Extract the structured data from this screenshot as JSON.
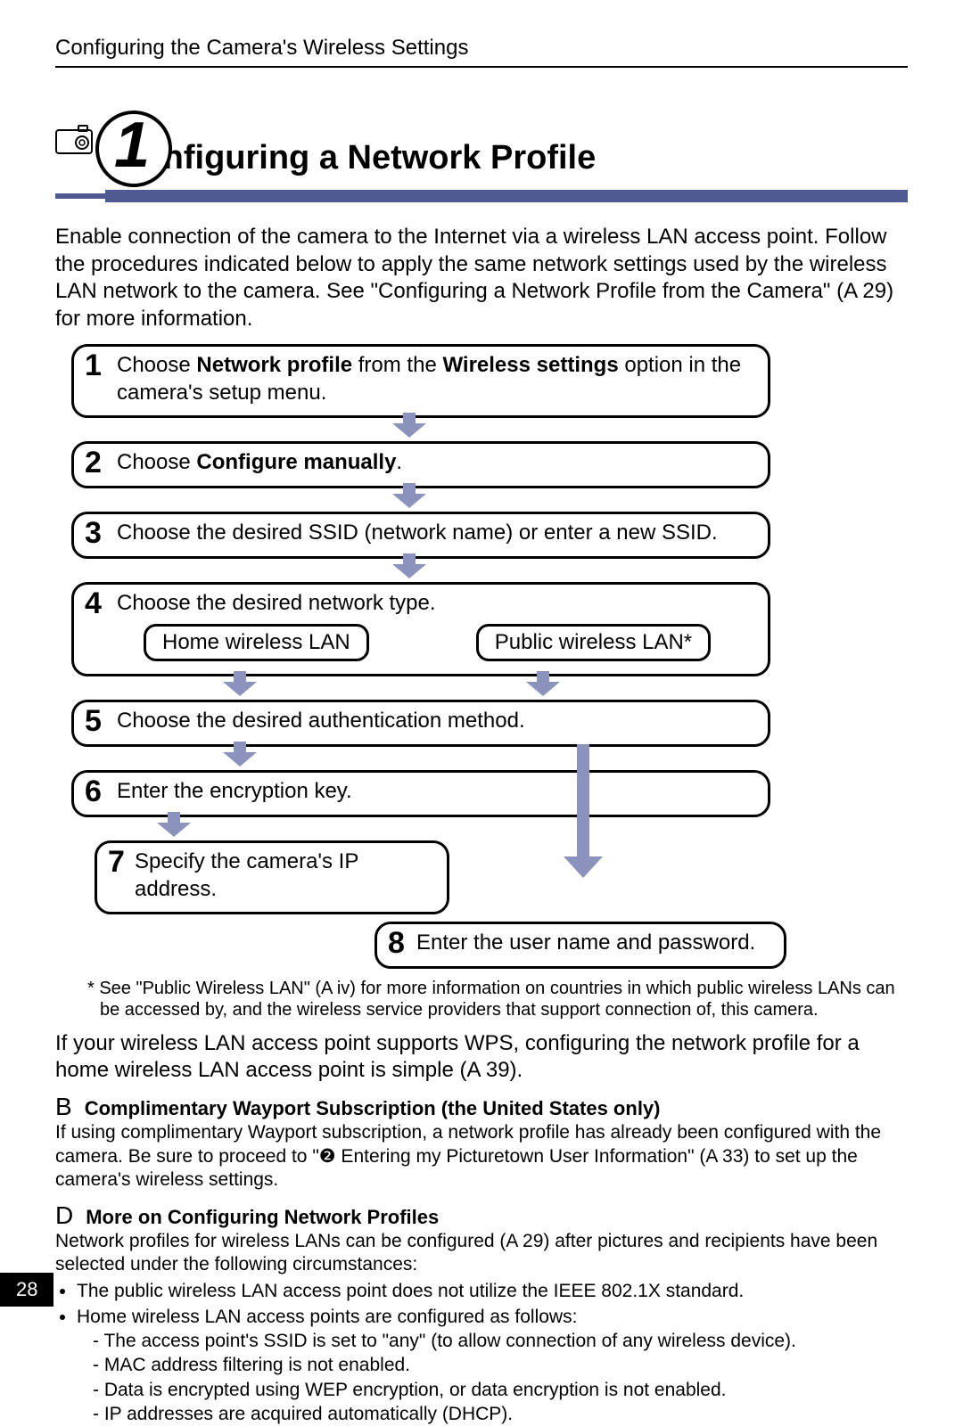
{
  "header": "Configuring the Camera's Wireless Settings",
  "section_number": "1",
  "title": "Configuring a Network Profile",
  "intro_text": "Enable connection of the camera to the Internet via a wireless LAN access point. Follow the procedures indicated below to apply the same network settings used by the wireless LAN network to the camera. See \"Configuring a Network Profile from the Camera\" (A  29) for more information.",
  "steps": {
    "s1": {
      "num": "1",
      "pre": "Choose ",
      "b1": "Network profile",
      "mid": " from the ",
      "b2": "Wireless settings",
      "post": " option in the camera's setup menu."
    },
    "s2": {
      "num": "2",
      "pre": "Choose ",
      "b1": "Configure manually",
      "post": "."
    },
    "s3": {
      "num": "3",
      "text": "Choose the desired SSID (network name) or enter a new SSID."
    },
    "s4": {
      "num": "4",
      "text": "Choose the desired network type.",
      "opt1": "Home wireless LAN",
      "opt2": "Public wireless LAN*"
    },
    "s5": {
      "num": "5",
      "text": "Choose the desired authentication method."
    },
    "s6": {
      "num": "6",
      "text": "Enter the encryption key."
    },
    "s7": {
      "num": "7",
      "text": "Specify the camera's IP address."
    },
    "s8": {
      "num": "8",
      "text": "Enter the user name and password."
    }
  },
  "footnote": "*  See \"Public Wireless LAN\" (A  iv) for more information on countries in which public wireless LANs can be accessed by, and the wireless service providers that support connection of, this camera.",
  "body_p": "If your wireless LAN access point supports WPS, configuring the network profile for a home wireless LAN access point is simple (A  39).",
  "noteB": {
    "sym": "B",
    "title": "Complimentary Wayport Subscription (the United States only)",
    "body": "If using complimentary Wayport subscription, a network profile has already been configured with the camera. Be sure to proceed to \"❷ Entering my Picturetown User Information\" (A  33) to set up the camera's wireless settings."
  },
  "noteD": {
    "sym": "D",
    "title": "More on Configuring Network Profiles",
    "intro": "Network profiles for wireless LANs can be configured (A  29) after pictures and recipients have been selected under the following circumstances:",
    "bul1": "The public wireless LAN access point does not utilize the IEEE 802.1X standard.",
    "bul2": "Home wireless LAN access points are configured as follows:",
    "d1": "The access point's SSID is set to \"any\" (to allow connection of any wireless device).",
    "d2": "MAC address filtering is not enabled.",
    "d3": "Data is encrypted using WEP encryption, or data encryption is not enabled.",
    "d4": "IP addresses are acquired automatically (DHCP)."
  },
  "page_number": "28"
}
